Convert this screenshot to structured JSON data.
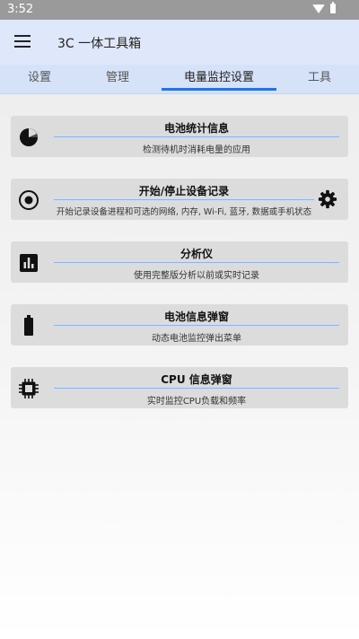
{
  "status_bar": {
    "time": "3:52",
    "icons": [
      "wifi-icon",
      "battery-icon"
    ]
  },
  "app_bar": {
    "menu_icon": "menu-icon",
    "title": "3C 一体工具箱"
  },
  "tabs": [
    {
      "label": "设置",
      "active": false
    },
    {
      "label": "管理",
      "active": false
    },
    {
      "label": "电量监控设置",
      "active": true
    },
    {
      "label": "工具",
      "active": false
    }
  ],
  "accent_color": "#2e6fe0",
  "cards": [
    {
      "icon": "pie-chart-icon",
      "title": "电池统计信息",
      "subtitle": "检测待机时消耗电量的应用"
    },
    {
      "icon": "record-icon",
      "title": "开始/停止设备记录",
      "subtitle": "开始记录设备进程和可选的网络, 内存, Wi-Fi, 蓝牙, 数据或手机状态",
      "trailing_icon": "gear-icon"
    },
    {
      "icon": "analytics-icon",
      "title": "分析仪",
      "subtitle": "使用完整版分析以前或实时记录"
    },
    {
      "icon": "battery-icon",
      "title": "电池信息弹窗",
      "subtitle": "动态电池监控弹出菜单"
    },
    {
      "icon": "cpu-chip-icon",
      "title": "CPU 信息弹窗",
      "subtitle": "实时监控CPU负载和频率"
    }
  ]
}
